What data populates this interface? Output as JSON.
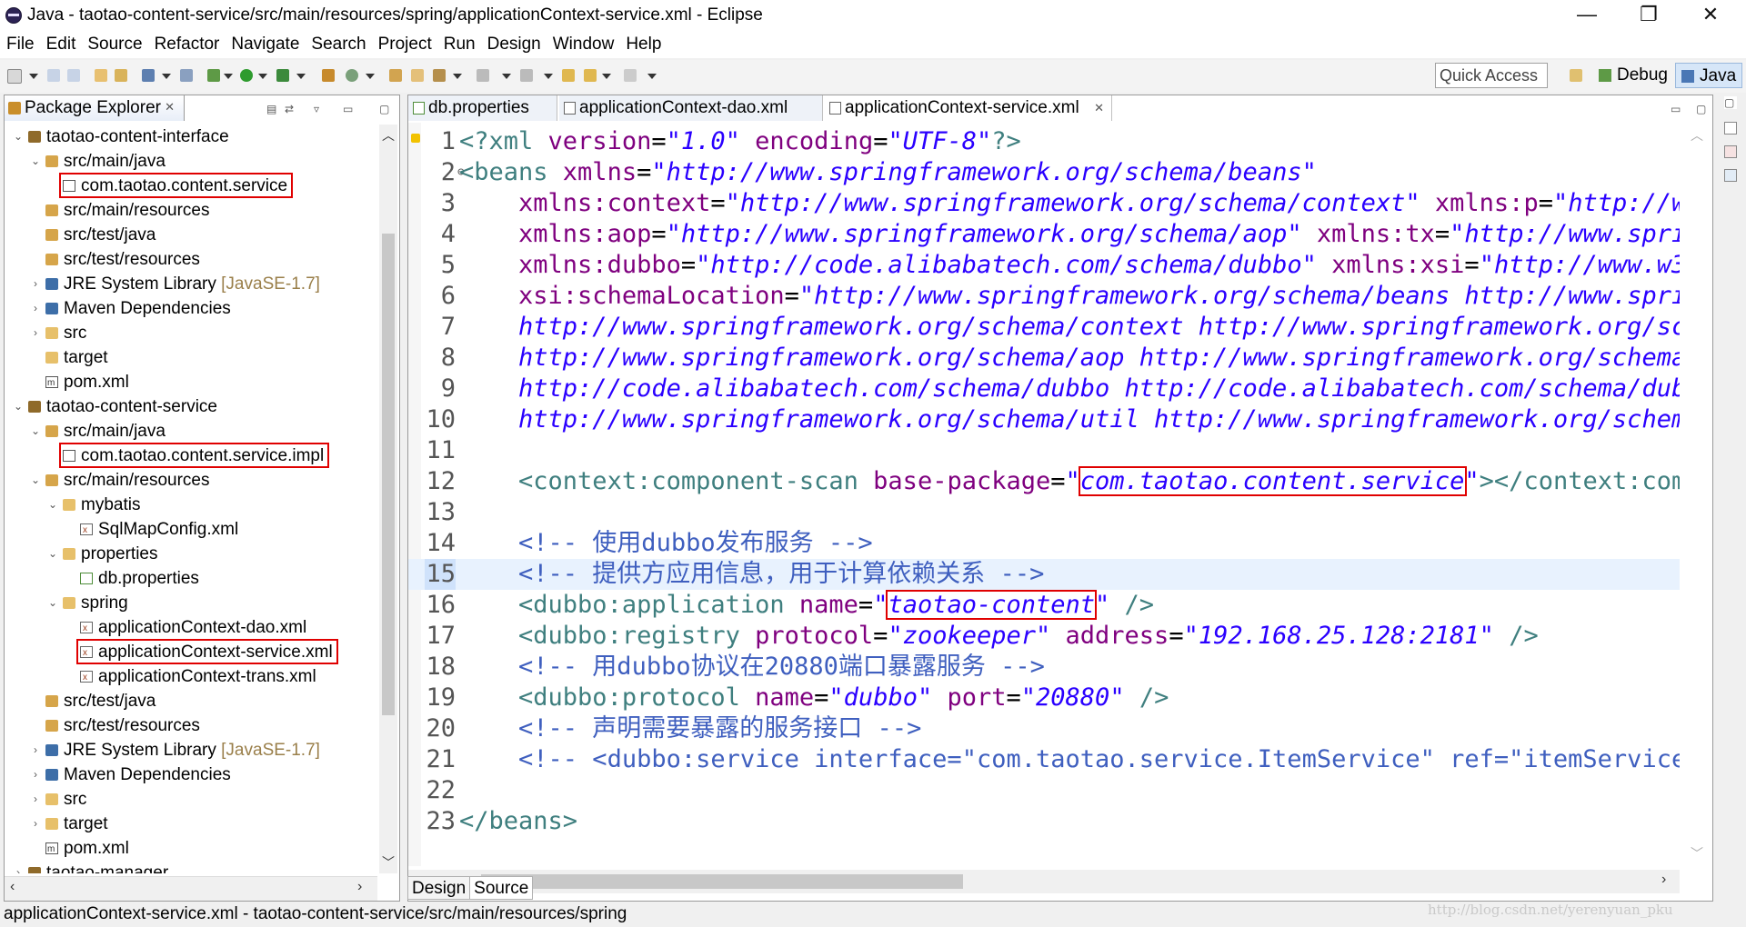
{
  "window": {
    "title": "Java - taotao-content-service/src/main/resources/spring/applicationContext-service.xml - Eclipse",
    "controls": {
      "minimize": "—",
      "maximize": "❐",
      "close": "✕"
    }
  },
  "menu": [
    "File",
    "Edit",
    "Source",
    "Refactor",
    "Navigate",
    "Search",
    "Project",
    "Run",
    "Design",
    "Window",
    "Help"
  ],
  "toolbar": {
    "quick_access": "Quick Access",
    "perspectives": [
      {
        "label": "Debug",
        "active": false
      },
      {
        "label": "Java",
        "active": true
      }
    ]
  },
  "package_explorer": {
    "tab_label": "Package Explorer",
    "tab_close": "✕",
    "tree": [
      {
        "label": "taotao-content-interface",
        "depth": 0,
        "twisty": "v",
        "icon": "project-icon",
        "icon_type": "proj"
      },
      {
        "label": "src/main/java",
        "depth": 1,
        "twisty": "v",
        "icon": "source-folder-icon",
        "icon_type": "srcf"
      },
      {
        "label": "com.taotao.content.service",
        "depth": 2,
        "twisty": "",
        "icon": "package-icon",
        "icon_type": "pkg",
        "highlight": true
      },
      {
        "label": "src/main/resources",
        "depth": 1,
        "twisty": "",
        "icon": "source-folder-icon",
        "icon_type": "srcf"
      },
      {
        "label": "src/test/java",
        "depth": 1,
        "twisty": "",
        "icon": "source-folder-icon",
        "icon_type": "srcf"
      },
      {
        "label": "src/test/resources",
        "depth": 1,
        "twisty": "",
        "icon": "source-folder-icon",
        "icon_type": "srcf"
      },
      {
        "label": "JRE System Library",
        "sublabel": "[JavaSE-1.7]",
        "depth": 1,
        "twisty": ">",
        "icon": "library-icon",
        "icon_type": "lib"
      },
      {
        "label": "Maven Dependencies",
        "depth": 1,
        "twisty": ">",
        "icon": "library-icon",
        "icon_type": "lib"
      },
      {
        "label": "src",
        "depth": 1,
        "twisty": ">",
        "icon": "folder-icon",
        "icon_type": "folder"
      },
      {
        "label": "target",
        "depth": 1,
        "twisty": "",
        "icon": "folder-icon",
        "icon_type": "folder"
      },
      {
        "label": "pom.xml",
        "depth": 1,
        "twisty": "",
        "icon": "pom-file-icon",
        "icon_type": "pom"
      },
      {
        "label": "taotao-content-service",
        "depth": 0,
        "twisty": "v",
        "icon": "project-icon",
        "icon_type": "proj"
      },
      {
        "label": "src/main/java",
        "depth": 1,
        "twisty": "v",
        "icon": "source-folder-icon",
        "icon_type": "srcf"
      },
      {
        "label": "com.taotao.content.service.impl",
        "depth": 2,
        "twisty": "",
        "icon": "package-icon",
        "icon_type": "pkg",
        "highlight": true
      },
      {
        "label": "src/main/resources",
        "depth": 1,
        "twisty": "v",
        "icon": "source-folder-icon",
        "icon_type": "srcf"
      },
      {
        "label": "mybatis",
        "depth": 2,
        "twisty": "v",
        "icon": "folder-icon",
        "icon_type": "folder"
      },
      {
        "label": "SqlMapConfig.xml",
        "depth": 3,
        "twisty": "",
        "icon": "xml-file-icon",
        "icon_type": "xml"
      },
      {
        "label": "properties",
        "depth": 2,
        "twisty": "v",
        "icon": "folder-icon",
        "icon_type": "folder"
      },
      {
        "label": "db.properties",
        "depth": 3,
        "twisty": "",
        "icon": "properties-file-icon",
        "icon_type": "props"
      },
      {
        "label": "spring",
        "depth": 2,
        "twisty": "v",
        "icon": "folder-icon",
        "icon_type": "folder"
      },
      {
        "label": "applicationContext-dao.xml",
        "depth": 3,
        "twisty": "",
        "icon": "xml-file-icon",
        "icon_type": "xml"
      },
      {
        "label": "applicationContext-service.xml",
        "depth": 3,
        "twisty": "",
        "icon": "xml-file-icon",
        "icon_type": "xml",
        "highlight": true
      },
      {
        "label": "applicationContext-trans.xml",
        "depth": 3,
        "twisty": "",
        "icon": "xml-file-icon",
        "icon_type": "xml"
      },
      {
        "label": "src/test/java",
        "depth": 1,
        "twisty": "",
        "icon": "source-folder-icon",
        "icon_type": "srcf"
      },
      {
        "label": "src/test/resources",
        "depth": 1,
        "twisty": "",
        "icon": "source-folder-icon",
        "icon_type": "srcf"
      },
      {
        "label": "JRE System Library",
        "sublabel": "[JavaSE-1.7]",
        "depth": 1,
        "twisty": ">",
        "icon": "library-icon",
        "icon_type": "lib"
      },
      {
        "label": "Maven Dependencies",
        "depth": 1,
        "twisty": ">",
        "icon": "library-icon",
        "icon_type": "lib"
      },
      {
        "label": "src",
        "depth": 1,
        "twisty": ">",
        "icon": "folder-icon",
        "icon_type": "folder"
      },
      {
        "label": "target",
        "depth": 1,
        "twisty": ">",
        "icon": "folder-icon",
        "icon_type": "folder"
      },
      {
        "label": "pom.xml",
        "depth": 1,
        "twisty": "",
        "icon": "pom-file-icon",
        "icon_type": "pom"
      },
      {
        "label": "taotao-manager",
        "depth": 0,
        "twisty": ">",
        "icon": "project-icon",
        "icon_type": "proj"
      }
    ]
  },
  "editor": {
    "tabs": [
      {
        "label": "db.properties",
        "active": false
      },
      {
        "label": "applicationContext-dao.xml",
        "active": false
      },
      {
        "label": "applicationContext-service.xml",
        "active": true
      }
    ],
    "current_line": 15,
    "lines": [
      [
        [
          "pi",
          "<?xml "
        ],
        [
          "attr",
          "version"
        ],
        [
          "text",
          "="
        ],
        [
          "str",
          "\"1.0\""
        ],
        [
          "text",
          " "
        ],
        [
          "attr",
          "encoding"
        ],
        [
          "text",
          "="
        ],
        [
          "str",
          "\"UTF-8\""
        ],
        [
          "pi",
          "?>"
        ]
      ],
      [
        [
          "tag",
          "<beans "
        ],
        [
          "attr",
          "xmlns"
        ],
        [
          "text",
          "="
        ],
        [
          "str",
          "\"http://www.springframework.org/schema/beans\""
        ]
      ],
      [
        [
          "text",
          "    "
        ],
        [
          "attr",
          "xmlns:context"
        ],
        [
          "text",
          "="
        ],
        [
          "str",
          "\"http://www.springframework.org/schema/context\""
        ],
        [
          "text",
          " "
        ],
        [
          "attr",
          "xmlns:p"
        ],
        [
          "text",
          "="
        ],
        [
          "str",
          "\"http://www"
        ]
      ],
      [
        [
          "text",
          "    "
        ],
        [
          "attr",
          "xmlns:aop"
        ],
        [
          "text",
          "="
        ],
        [
          "str",
          "\"http://www.springframework.org/schema/aop\""
        ],
        [
          "text",
          " "
        ],
        [
          "attr",
          "xmlns:tx"
        ],
        [
          "text",
          "="
        ],
        [
          "str",
          "\"http://www.sprin"
        ]
      ],
      [
        [
          "text",
          "    "
        ],
        [
          "attr",
          "xmlns:dubbo"
        ],
        [
          "text",
          "="
        ],
        [
          "str",
          "\"http://code.alibabatech.com/schema/dubbo\""
        ],
        [
          "text",
          " "
        ],
        [
          "attr",
          "xmlns:xsi"
        ],
        [
          "text",
          "="
        ],
        [
          "str",
          "\"http://www.w3."
        ]
      ],
      [
        [
          "text",
          "    "
        ],
        [
          "attr",
          "xsi:schemaLocation"
        ],
        [
          "text",
          "="
        ],
        [
          "str",
          "\"http://www.springframework.org/schema/beans http://www.sprin"
        ]
      ],
      [
        [
          "text",
          "    "
        ],
        [
          "str",
          "http://www.springframework.org/schema/context http://www.springframework.org/sch"
        ]
      ],
      [
        [
          "text",
          "    "
        ],
        [
          "str",
          "http://www.springframework.org/schema/aop http://www.springframework.org/schema/"
        ]
      ],
      [
        [
          "text",
          "    "
        ],
        [
          "str",
          "http://code.alibabatech.com/schema/dubbo http://code.alibabatech.com/schema/dubb"
        ]
      ],
      [
        [
          "text",
          "    "
        ],
        [
          "str",
          "http://www.springframework.org/schema/util http://www.springframework.org/schema"
        ]
      ],
      [],
      [
        [
          "text",
          "    "
        ],
        [
          "tag",
          "<context:component-scan "
        ],
        [
          "attr",
          "base-package"
        ],
        [
          "text",
          "="
        ],
        [
          "str",
          "\"com.taotao.content.service\""
        ],
        [
          "tag",
          "></context:comp"
        ]
      ],
      [],
      [
        [
          "text",
          "    "
        ],
        [
          "com",
          "<!-- 使用dubbo发布服务 -->"
        ]
      ],
      [
        [
          "text",
          "    "
        ],
        [
          "com",
          "<!-- 提供方应用信息，用于计算依赖关系 -->"
        ]
      ],
      [
        [
          "text",
          "    "
        ],
        [
          "tag",
          "<dubbo:application "
        ],
        [
          "attr",
          "name"
        ],
        [
          "text",
          "="
        ],
        [
          "str",
          "\"taotao-content\""
        ],
        [
          "tag",
          " />"
        ]
      ],
      [
        [
          "text",
          "    "
        ],
        [
          "tag",
          "<dubbo:registry "
        ],
        [
          "attr",
          "protocol"
        ],
        [
          "text",
          "="
        ],
        [
          "str",
          "\"zookeeper\""
        ],
        [
          "text",
          " "
        ],
        [
          "attr",
          "address"
        ],
        [
          "text",
          "="
        ],
        [
          "str",
          "\"192.168.25.128:2181\""
        ],
        [
          "tag",
          " />"
        ]
      ],
      [
        [
          "text",
          "    "
        ],
        [
          "com",
          "<!-- 用dubbo协议在20880端口暴露服务 -->"
        ]
      ],
      [
        [
          "text",
          "    "
        ],
        [
          "tag",
          "<dubbo:protocol "
        ],
        [
          "attr",
          "name"
        ],
        [
          "text",
          "="
        ],
        [
          "str",
          "\"dubbo\""
        ],
        [
          "text",
          " "
        ],
        [
          "attr",
          "port"
        ],
        [
          "text",
          "="
        ],
        [
          "str",
          "\"20880\""
        ],
        [
          "tag",
          " />"
        ]
      ],
      [
        [
          "text",
          "    "
        ],
        [
          "com",
          "<!-- 声明需要暴露的服务接口 -->"
        ]
      ],
      [
        [
          "text",
          "    "
        ],
        [
          "com",
          "<!-- <dubbo:service interface=\"com.taotao.service.ItemService\" ref=\"itemServiceI"
        ]
      ],
      [],
      [
        [
          "tag",
          "</beans>"
        ]
      ]
    ]
  },
  "bottom_tabs": [
    {
      "label": "Design",
      "active": false
    },
    {
      "label": "Source",
      "active": true
    }
  ],
  "status": {
    "text": "applicationContext-service.xml - taotao-content-service/src/main/resources/spring",
    "watermark": "http://blog.csdn.net/yerenyuan_pku"
  }
}
